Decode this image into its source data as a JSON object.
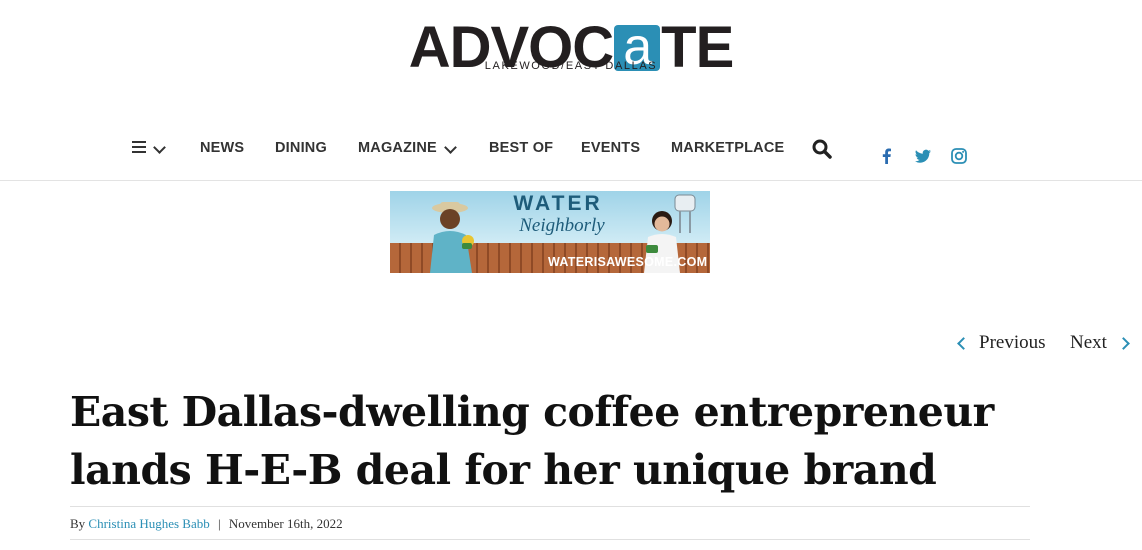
{
  "logo": {
    "word_before": "ADVOC",
    "word_accent": "a",
    "word_after": "TE",
    "tagline": "LAKEWOOD/EAST DALLAS"
  },
  "nav": {
    "items": [
      {
        "label": "NEWS"
      },
      {
        "label": "DINING"
      },
      {
        "label": "MAGAZINE",
        "has_dropdown": true
      },
      {
        "label": "BEST OF"
      },
      {
        "label": "EVENTS"
      },
      {
        "label": "MARKETPLACE"
      }
    ],
    "icons": [
      "menu-icon",
      "chevron-down-icon",
      "search-icon",
      "facebook-icon",
      "twitter-icon",
      "instagram-icon"
    ]
  },
  "ad": {
    "headline": "WATER",
    "subhead": "Neighborly",
    "url": "WATERISAWESOME.COM"
  },
  "pagination": {
    "previous": "Previous",
    "next": "Next"
  },
  "article": {
    "title": "East Dallas-dwelling coffee entrepreneur lands H-E-B deal for her unique brand",
    "by_label": "By",
    "author": "Christina Hughes Babb",
    "separator": "|",
    "date": "November 16th, 2022"
  },
  "colors": {
    "accent": "#2b8fb5",
    "text": "#111111",
    "nav_text": "#333333"
  }
}
